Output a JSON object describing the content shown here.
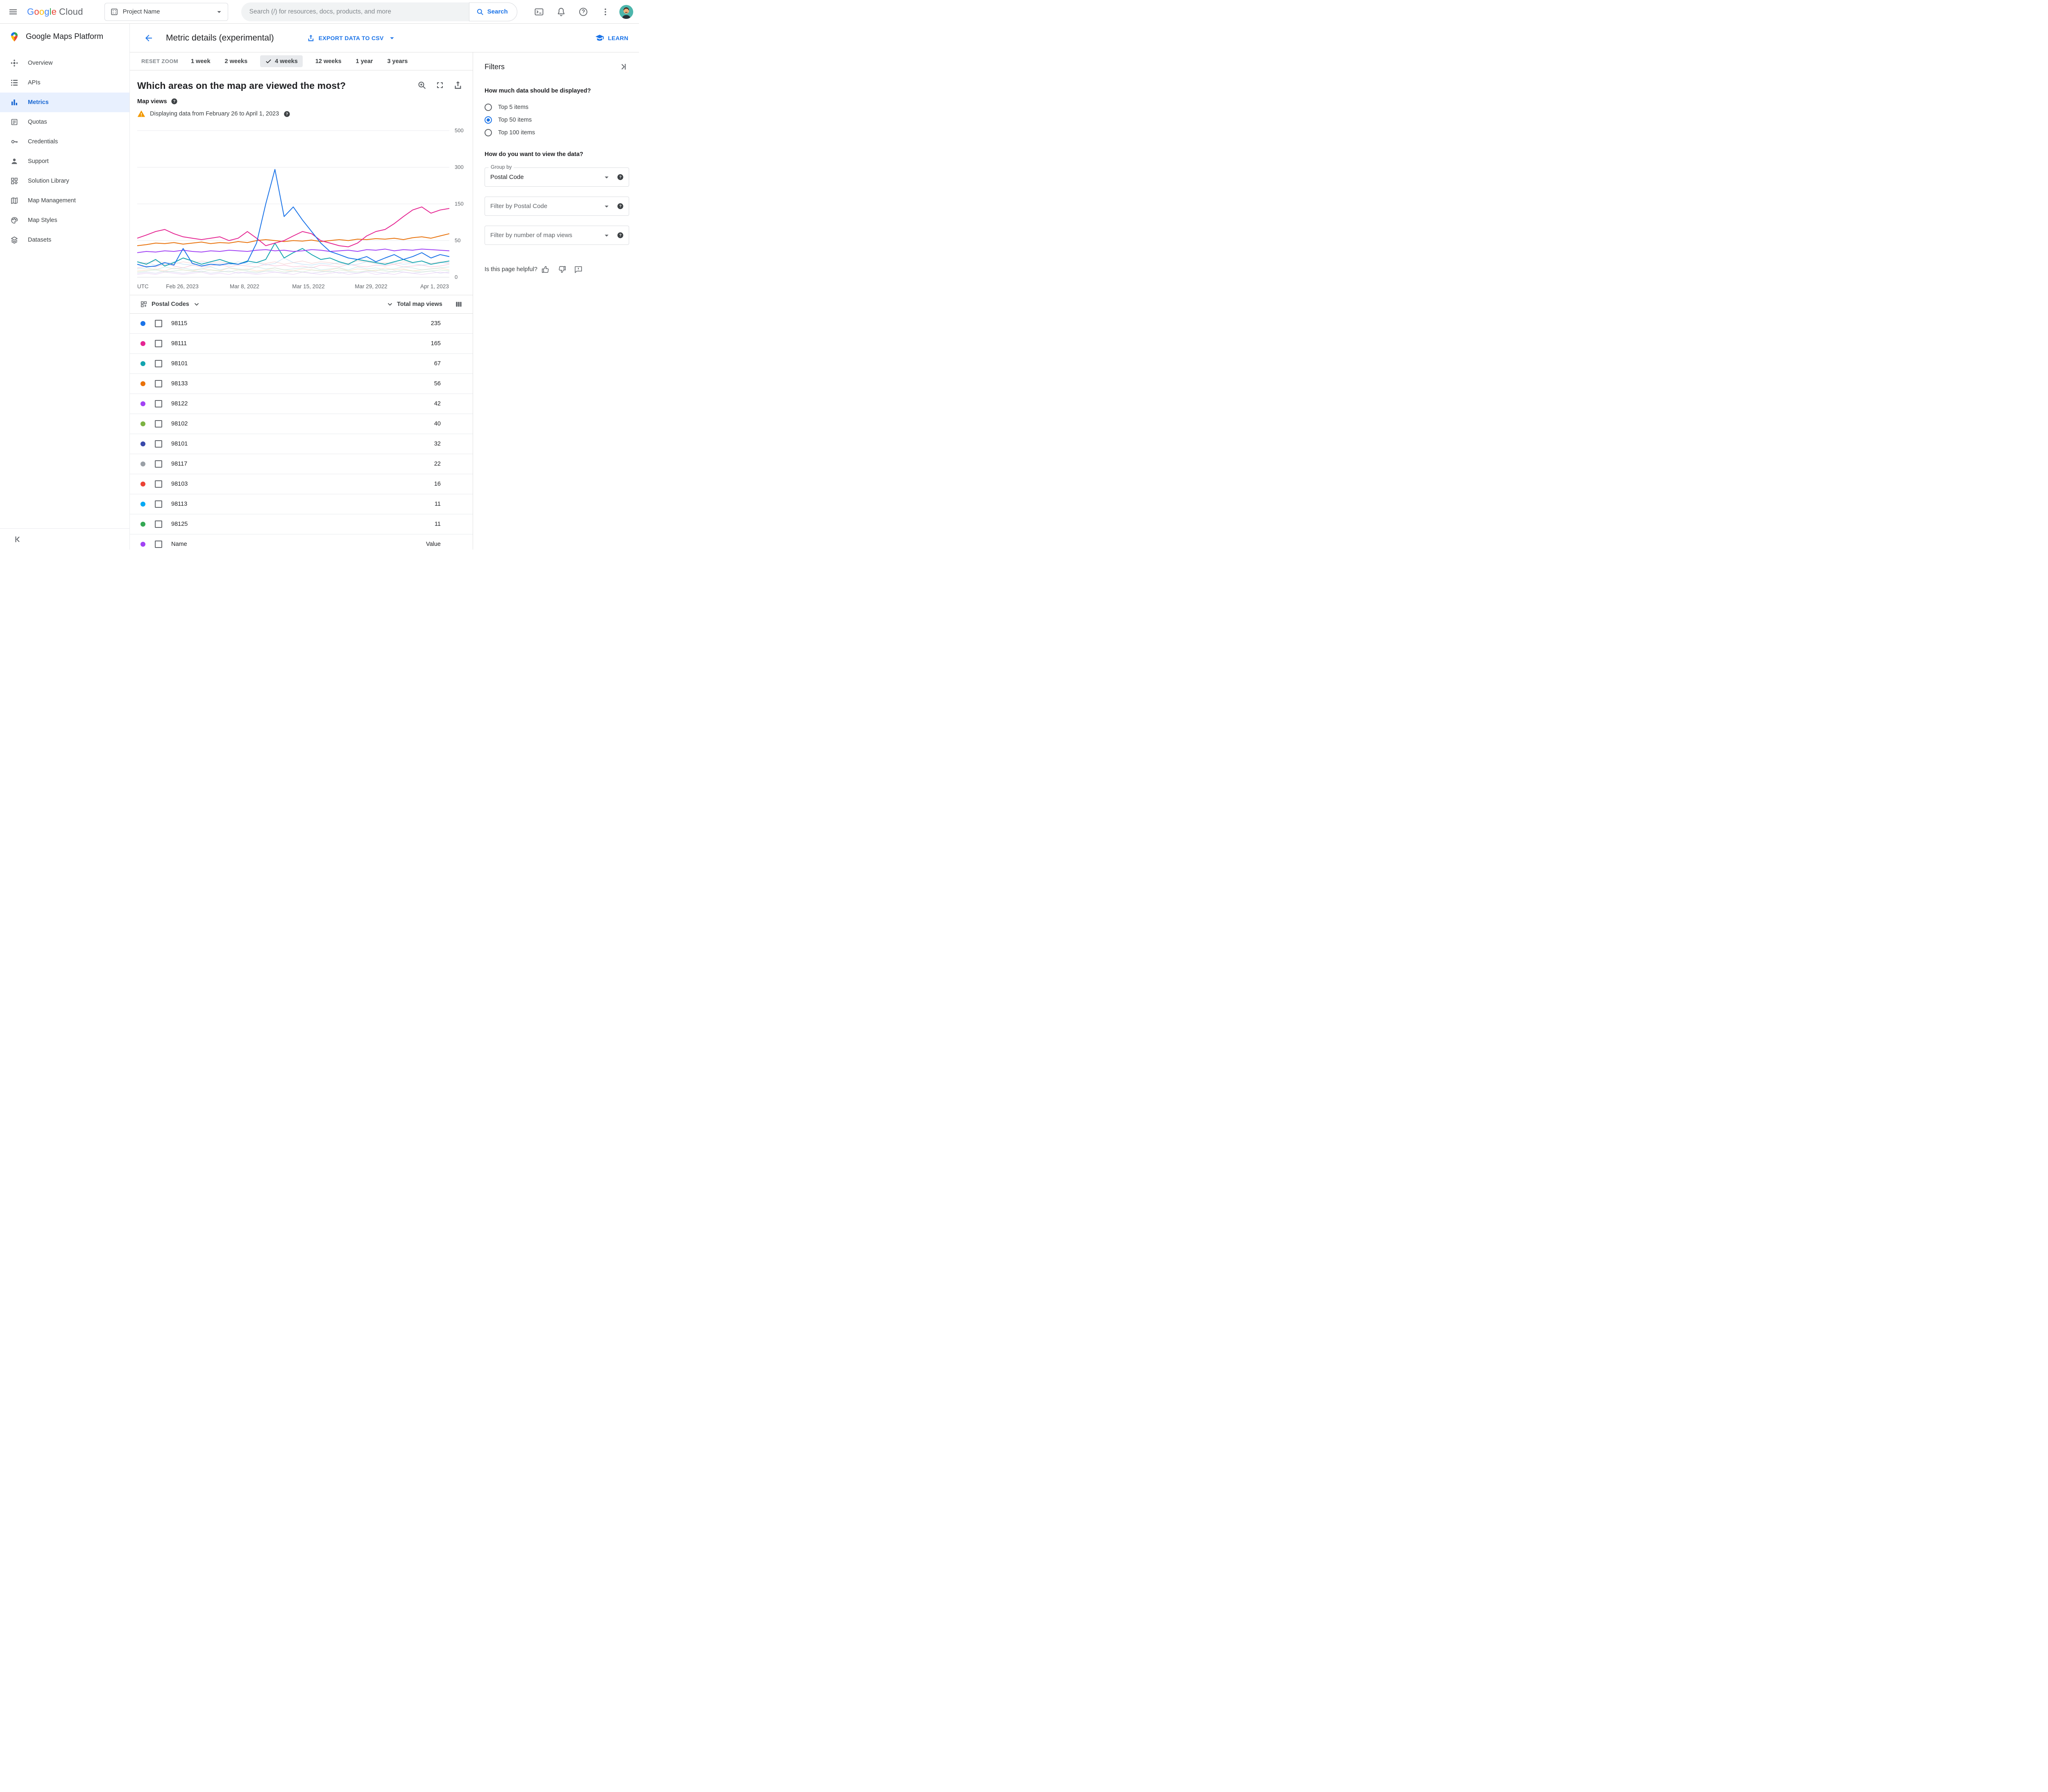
{
  "topbar": {
    "logo_letters": [
      "G",
      "o",
      "o",
      "g",
      "l",
      "e"
    ],
    "logo_cloud": "Cloud",
    "project_selector": "Project Name",
    "search_placeholder": "Search (/) for resources, docs, products, and more",
    "search_button": "Search"
  },
  "sidebar": {
    "title": "Google Maps Platform",
    "items": [
      {
        "label": "Overview"
      },
      {
        "label": "APIs"
      },
      {
        "label": "Metrics"
      },
      {
        "label": "Quotas"
      },
      {
        "label": "Credentials"
      },
      {
        "label": "Support"
      },
      {
        "label": "Solution Library"
      },
      {
        "label": "Map Management"
      },
      {
        "label": "Map Styles"
      },
      {
        "label": "Datasets"
      }
    ],
    "selected": "Metrics"
  },
  "header": {
    "title": "Metric details (experimental)",
    "export_button": "EXPORT DATA TO CSV",
    "learn_button": "LEARN"
  },
  "time_range": {
    "reset_zoom": "RESET ZOOM",
    "options": [
      "1 week",
      "2 weeks",
      "4 weeks",
      "12 weeks",
      "1 year",
      "3 years"
    ],
    "selected": "4 weeks"
  },
  "chart": {
    "title": "Which areas on the map are viewed the most?",
    "metric_label": "Map views",
    "warning": "Displaying data from February 26 to April 1, 2023"
  },
  "chart_data": {
    "type": "line",
    "title": "Which areas on the map are viewed the most?",
    "metric_label": "Map views",
    "date_range": "February 26 to April 1, 2023",
    "x_axis": {
      "timezone": "UTC",
      "tick_labels": [
        "Feb 26, 2023",
        "Mar 8, 2022",
        "Mar 15, 2022",
        "Mar 29, 2022",
        "Apr 1, 2023"
      ]
    },
    "y_axis": {
      "tick_values": [
        0,
        50,
        150,
        300,
        500
      ],
      "scale": "quadratic"
    },
    "series": [
      {
        "name": "98115",
        "color": "#1a73e8",
        "values": [
          12,
          9,
          10,
          14,
          11,
          35,
          13,
          10,
          12,
          11,
          13,
          12,
          15,
          45,
          150,
          290,
          110,
          140,
          100,
          70,
          45,
          30,
          25,
          20,
          18,
          22,
          15,
          20,
          25,
          18,
          22,
          28,
          20,
          25,
          22
        ]
      },
      {
        "name": "98111",
        "color": "#e52592",
        "values": [
          55,
          62,
          70,
          75,
          65,
          58,
          55,
          52,
          55,
          58,
          50,
          55,
          70,
          55,
          40,
          45,
          50,
          60,
          70,
          65,
          50,
          45,
          40,
          38,
          45,
          60,
          70,
          75,
          90,
          110,
          130,
          140,
          120,
          130,
          135
        ]
      },
      {
        "name": "98133",
        "color": "#e8710a",
        "values": [
          40,
          42,
          45,
          44,
          46,
          43,
          45,
          47,
          44,
          46,
          45,
          48,
          46,
          50,
          52,
          50,
          48,
          50,
          49,
          51,
          48,
          50,
          52,
          50,
          53,
          52,
          54,
          53,
          55,
          52,
          56,
          58,
          55,
          60,
          65
        ]
      },
      {
        "name": "98122",
        "color": "#a142f4",
        "values": [
          28,
          30,
          29,
          31,
          30,
          32,
          30,
          29,
          31,
          30,
          32,
          31,
          30,
          32,
          33,
          31,
          32,
          30,
          31,
          33,
          32,
          30,
          31,
          32,
          30,
          33,
          32,
          34,
          31,
          33,
          32,
          34,
          33,
          32,
          31
        ]
      },
      {
        "name": "98101",
        "color": "#12a4af",
        "values": [
          15,
          12,
          18,
          10,
          14,
          20,
          16,
          12,
          15,
          18,
          14,
          12,
          16,
          14,
          18,
          45,
          20,
          28,
          35,
          25,
          18,
          20,
          15,
          12,
          18,
          16,
          14,
          12,
          15,
          18,
          14,
          16,
          12,
          14,
          16
        ]
      }
    ],
    "background_series": [
      {
        "color": "#f6aecb",
        "values": [
          8,
          10,
          9,
          12,
          10,
          8,
          11,
          9,
          10,
          12,
          9,
          11,
          10,
          9,
          12,
          10,
          11,
          9,
          10,
          8,
          11,
          10,
          9,
          12,
          10,
          9,
          11,
          10,
          12,
          9,
          10,
          11,
          9,
          10,
          12
        ]
      },
      {
        "color": "#ffd3b6",
        "values": [
          5,
          6,
          7,
          5,
          8,
          6,
          5,
          7,
          6,
          5,
          8,
          6,
          7,
          5,
          6,
          8,
          6,
          5,
          7,
          6,
          5,
          6,
          8,
          5,
          7,
          6,
          5,
          8,
          6,
          7,
          5,
          6,
          7,
          8,
          6
        ]
      },
      {
        "color": "#aed6f1",
        "values": [
          12,
          14,
          11,
          13,
          15,
          12,
          11,
          14,
          12,
          13,
          11,
          15,
          12,
          14,
          11,
          13,
          20,
          14,
          12,
          11,
          13,
          12,
          14,
          11,
          12,
          15,
          13,
          11,
          14,
          12,
          13,
          11,
          12,
          14,
          13
        ]
      },
      {
        "color": "#c9cfef",
        "values": [
          3,
          4,
          3,
          5,
          4,
          3,
          4,
          5,
          3,
          4,
          5,
          3,
          4,
          3,
          5,
          4,
          3,
          5,
          4,
          3,
          4,
          5,
          3,
          4,
          3,
          5,
          4,
          3,
          5,
          4,
          3,
          4,
          5,
          3,
          4
        ]
      },
      {
        "color": "#b7e2de",
        "values": [
          7,
          8,
          6,
          9,
          7,
          8,
          6,
          7,
          9,
          6,
          8,
          7,
          6,
          9,
          7,
          8,
          6,
          7,
          8,
          9,
          6,
          7,
          8,
          6,
          9,
          7,
          8,
          6,
          7,
          9,
          8,
          6,
          7,
          8,
          9
        ]
      },
      {
        "color": "#e5c6f2",
        "values": [
          2,
          3,
          2,
          4,
          3,
          2,
          3,
          4,
          2,
          3,
          2,
          4,
          3,
          2,
          3,
          4,
          3,
          2,
          4,
          3,
          2,
          3,
          4,
          2,
          3,
          4,
          2,
          3,
          2,
          4,
          3,
          2,
          3,
          4,
          3
        ]
      },
      {
        "color": "#f2c4c4",
        "values": [
          15,
          13,
          16,
          14,
          12,
          15,
          13,
          16,
          14,
          15,
          13,
          12,
          16,
          14,
          13,
          15,
          12,
          14,
          16,
          13,
          15,
          14,
          12,
          13,
          16,
          15,
          13,
          14,
          12,
          15,
          14,
          16,
          13,
          15,
          14
        ]
      },
      {
        "color": "#c8e6c9",
        "values": [
          4,
          5,
          6,
          4,
          5,
          6,
          5,
          4,
          6,
          5,
          4,
          6,
          5,
          4,
          5,
          6,
          4,
          5,
          4,
          6,
          5,
          4,
          6,
          5,
          4,
          5,
          6,
          5,
          4,
          6,
          5,
          4,
          5,
          6,
          5
        ]
      }
    ]
  },
  "table": {
    "group_header": "Postal Codes",
    "value_header": "Total map views",
    "rows": [
      {
        "code": "98115",
        "value": "235",
        "color": "#1a73e8"
      },
      {
        "code": "98111",
        "value": "165",
        "color": "#e52592"
      },
      {
        "code": "98101",
        "value": "67",
        "color": "#12a4af"
      },
      {
        "code": "98133",
        "value": "56",
        "color": "#e8710a"
      },
      {
        "code": "98122",
        "value": "42",
        "color": "#a142f4"
      },
      {
        "code": "98102",
        "value": "40",
        "color": "#7cb342"
      },
      {
        "code": "98101",
        "value": "32",
        "color": "#3949ab"
      },
      {
        "code": "98117",
        "value": "22",
        "color": "#9aa0a6"
      },
      {
        "code": "98103",
        "value": "16",
        "color": "#ea4335"
      },
      {
        "code": "98113",
        "value": "11",
        "color": "#03a9f4"
      },
      {
        "code": "98125",
        "value": "11",
        "color": "#34a853"
      }
    ],
    "partial_row": {
      "code": "Name",
      "value": "Value",
      "color": "#a142f4"
    }
  },
  "filters": {
    "title": "Filters",
    "data_amount_question": "How much data should be displayed?",
    "data_amount_options": [
      {
        "label": "Top 5 items",
        "selected": false
      },
      {
        "label": "Top 50 items",
        "selected": true
      },
      {
        "label": "Top 100 items",
        "selected": false
      }
    ],
    "view_question": "How do you want to view the data?",
    "group_by_label": "Group by",
    "group_by_value": "Postal Code",
    "filter_postal_placeholder": "Filter by Postal Code",
    "filter_views_placeholder": "Filter by number of map views",
    "helpful_question": "Is this page helpful?"
  },
  "colors": {
    "accent": "#1a73e8",
    "selected_nav_bg": "#e8f0fe",
    "selected_nav_text": "#1967d2",
    "warning": "#f29900"
  }
}
